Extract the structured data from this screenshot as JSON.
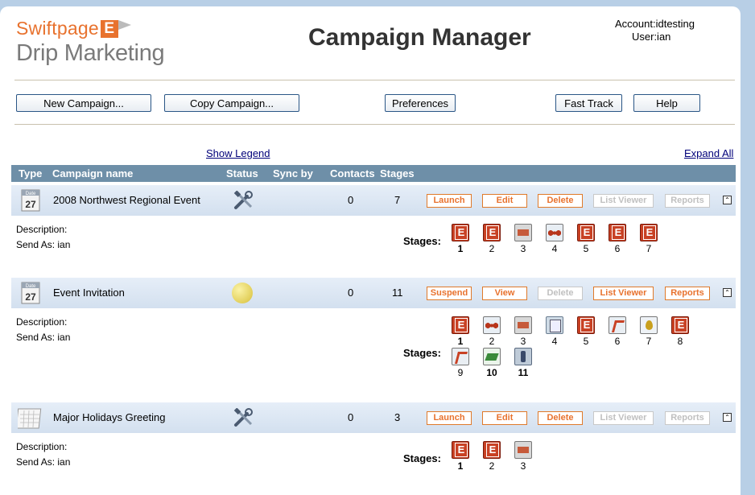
{
  "brand": {
    "line1": "Swiftpage",
    "badge": "E",
    "line2": "Drip Marketing",
    "accent": "#e8722e"
  },
  "app_title": "Campaign Manager",
  "account": {
    "account_text": "Account:idtesting",
    "user_text": "User:ian"
  },
  "toolbar": {
    "new_campaign": "New Campaign...",
    "copy_campaign": "Copy Campaign...",
    "preferences": "Preferences",
    "fast_track": "Fast Track",
    "help": "Help"
  },
  "links": {
    "show_legend": "Show Legend",
    "expand_all": "Expand All"
  },
  "table_headers": {
    "type": "Type",
    "name": "Campaign name",
    "status": "Status",
    "sync": "Sync by",
    "contacts": "Contacts",
    "stages": "Stages"
  },
  "labels": {
    "description": "Description:",
    "stages": "Stages:"
  },
  "campaigns": [
    {
      "name": "2008 Northwest Regional Event",
      "type_icon": "calendar-27-icon",
      "status_icon": "tools-icon",
      "contacts": "0",
      "stages": "7",
      "send_as": "Send As: ian",
      "actions": [
        {
          "label": "Launch",
          "enabled": true
        },
        {
          "label": "Edit",
          "enabled": true
        },
        {
          "label": "Delete",
          "enabled": true
        },
        {
          "label": "List Viewer",
          "enabled": false
        },
        {
          "label": "Reports",
          "enabled": false
        }
      ],
      "stage_list": [
        {
          "num": "1",
          "icon": "email"
        },
        {
          "num": "2",
          "icon": "email"
        },
        {
          "num": "3",
          "icon": "card"
        },
        {
          "num": "4",
          "icon": "people"
        },
        {
          "num": "5",
          "icon": "email"
        },
        {
          "num": "6",
          "icon": "email"
        },
        {
          "num": "7",
          "icon": "email"
        }
      ]
    },
    {
      "name": "Event Invitation",
      "type_icon": "calendar-27-icon",
      "status_icon": "running-moon-icon",
      "contacts": "0",
      "stages": "11",
      "send_as": "Send As: ian",
      "actions": [
        {
          "label": "Suspend",
          "enabled": true
        },
        {
          "label": "View",
          "enabled": true
        },
        {
          "label": "Delete",
          "enabled": false
        },
        {
          "label": "List Viewer",
          "enabled": true
        },
        {
          "label": "Reports",
          "enabled": true
        }
      ],
      "stage_list": [
        {
          "num": "1",
          "icon": "email"
        },
        {
          "num": "2",
          "icon": "people"
        },
        {
          "num": "3",
          "icon": "card"
        },
        {
          "num": "4",
          "icon": "fax"
        },
        {
          "num": "5",
          "icon": "email"
        },
        {
          "num": "6",
          "icon": "split"
        },
        {
          "num": "7",
          "icon": "drop"
        },
        {
          "num": "8",
          "icon": "email"
        },
        {
          "num": "9",
          "icon": "split"
        },
        {
          "num": "10",
          "icon": "csv"
        },
        {
          "num": "11",
          "icon": "phone"
        }
      ]
    },
    {
      "name": "Major Holidays Greeting",
      "type_icon": "calendar-grid-icon",
      "status_icon": "tools-icon",
      "contacts": "0",
      "stages": "3",
      "send_as": "Send As: ian",
      "actions": [
        {
          "label": "Launch",
          "enabled": true
        },
        {
          "label": "Edit",
          "enabled": true
        },
        {
          "label": "Delete",
          "enabled": true
        },
        {
          "label": "List Viewer",
          "enabled": false
        },
        {
          "label": "Reports",
          "enabled": false
        }
      ],
      "stage_list": [
        {
          "num": "1",
          "icon": "email"
        },
        {
          "num": "2",
          "icon": "email"
        },
        {
          "num": "3",
          "icon": "card"
        }
      ]
    }
  ]
}
